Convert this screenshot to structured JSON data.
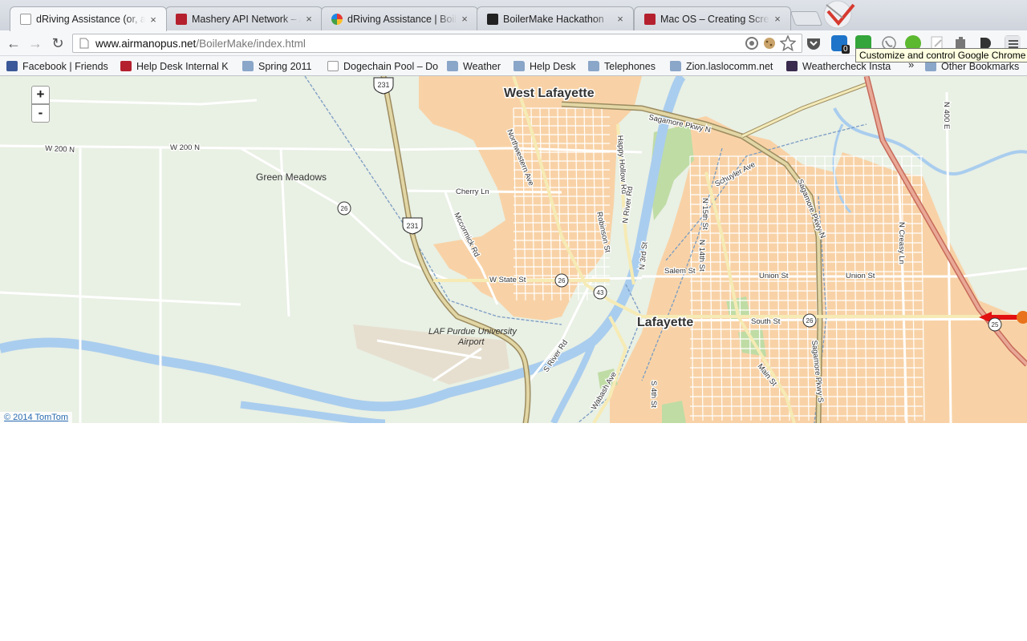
{
  "browser": {
    "tabs": [
      {
        "title": "dRiving Assistance (or, a h",
        "favicon": "page-icon",
        "active": true
      },
      {
        "title": "Mashery API Network – API",
        "favicon": "mashery-icon",
        "active": false
      },
      {
        "title": "dRiving Assistance | Boiler",
        "favicon": "pinwheel-icon",
        "active": false
      },
      {
        "title": "BoilerMake Hackathon",
        "favicon": "boilermake-icon",
        "active": false
      },
      {
        "title": "Mac OS – Creating Screens",
        "favicon": "kb-icon",
        "active": false
      }
    ],
    "close_glyph": "×",
    "url_host": "www.airmanopus.net",
    "url_path": "/BoilerMake/index.html",
    "extension_badge": "0",
    "tooltip": "Customize and control Google Chrome"
  },
  "bookmarks": {
    "items": [
      {
        "label": "Facebook | Friends",
        "icon": "facebook-icon"
      },
      {
        "label": "Help Desk Internal K",
        "icon": "kb-icon"
      },
      {
        "label": "Spring 2011",
        "icon": "folder-icon"
      },
      {
        "label": "Dogechain Pool – Do",
        "icon": "page-icon"
      },
      {
        "label": "Weather",
        "icon": "folder-icon"
      },
      {
        "label": "Help Desk",
        "icon": "folder-icon"
      },
      {
        "label": "Telephones",
        "icon": "folder-icon"
      },
      {
        "label": "Zion.laslocomm.net",
        "icon": "folder-icon"
      },
      {
        "label": "Weathercheck Insta",
        "icon": "b-icon"
      }
    ],
    "overflow": "»",
    "other": "Other Bookmarks"
  },
  "map": {
    "zoom_in": "+",
    "zoom_out": "-",
    "attribution": "© 2014 TomTom",
    "places": {
      "west_lafayette": "West Lafayette",
      "lafayette": "Lafayette",
      "green_meadows": "Green Meadows",
      "airport": "LAF Purdue University",
      "airport2": "Airport"
    },
    "roads": {
      "w200n_a": "W 200 N",
      "w200n_b": "W 200 N",
      "sagamore_n": "Sagamore Pkwy N",
      "sagamore_s": "Sagamore Pkwy S",
      "sagamore_n2": "Sagamore Pkwy N",
      "northwestern": "Northwestern Ave",
      "happy_hollow": "Happy Hollow Rd",
      "cherry": "Cherry Ln",
      "mccormick": "Mccormick Rd",
      "robinson": "Robinson St",
      "n_river": "N River Rd",
      "schuyler": "Schuyler Ave",
      "n15": "N 15th St",
      "n14": "N 14th St",
      "n3": "N 3rd St",
      "salem": "Salem St",
      "union1": "Union St",
      "union2": "Union St",
      "w_state": "W State St",
      "south": "South St",
      "s_river": "S River Rd",
      "wabash": "Wabash Ave",
      "s4": "S 4th St",
      "main": "Main St",
      "n_creasy": "N Creasy Ln",
      "n400e": "N 400 E"
    },
    "shields": {
      "us231a": "231",
      "us231b": "231",
      "sr26a": "26",
      "sr26b": "26",
      "sr26c": "26",
      "sr43": "43",
      "sr25": "25"
    }
  }
}
